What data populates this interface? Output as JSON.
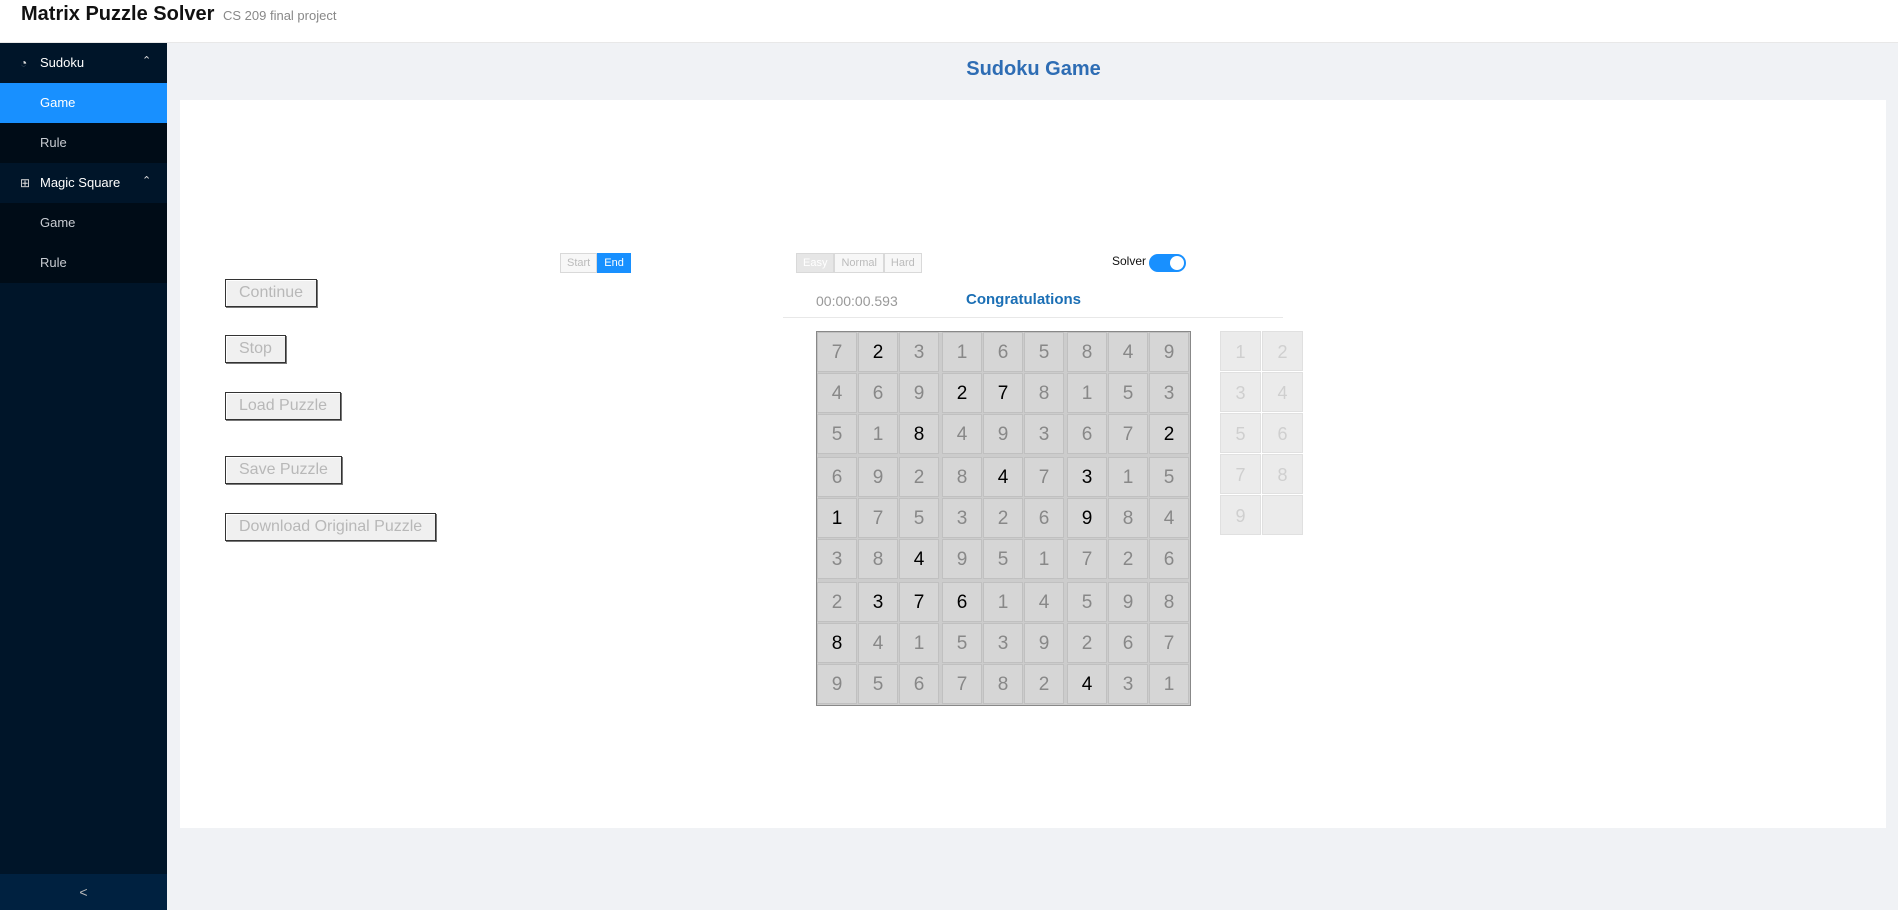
{
  "header": {
    "title": "Matrix Puzzle Solver",
    "subtitle": "CS 209 final project"
  },
  "sidebar": {
    "groups": [
      {
        "label": "Sudoku",
        "icon": "pie-chart-icon",
        "items": [
          {
            "label": "Game",
            "active": true
          },
          {
            "label": "Rule",
            "active": false
          }
        ]
      },
      {
        "label": "Magic Square",
        "icon": "grid-icon",
        "items": [
          {
            "label": "Game",
            "active": false
          },
          {
            "label": "Rule",
            "active": false
          }
        ]
      }
    ],
    "collapse_glyph": "<"
  },
  "page": {
    "title": "Sudoku Game"
  },
  "controls": {
    "buttons": {
      "continue": "Continue",
      "stop": "Stop",
      "load": "Load Puzzle",
      "save": "Save Puzzle",
      "download": "Download Original Puzzle"
    },
    "start_end": {
      "start": "Start",
      "end": "End",
      "selected": "End"
    },
    "difficulty": {
      "easy": "Easy",
      "normal": "Normal",
      "hard": "Hard",
      "selected": "Easy"
    },
    "solver": {
      "label": "Solver",
      "on": true
    }
  },
  "status": {
    "timer": "00:00:00.593",
    "message": "Congratulations"
  },
  "board": {
    "values": [
      [
        7,
        2,
        3,
        1,
        6,
        5,
        8,
        4,
        9
      ],
      [
        4,
        6,
        9,
        2,
        7,
        8,
        1,
        5,
        3
      ],
      [
        5,
        1,
        8,
        4,
        9,
        3,
        6,
        7,
        2
      ],
      [
        6,
        9,
        2,
        8,
        4,
        7,
        3,
        1,
        5
      ],
      [
        1,
        7,
        5,
        3,
        2,
        6,
        9,
        8,
        4
      ],
      [
        3,
        8,
        4,
        9,
        5,
        1,
        7,
        2,
        6
      ],
      [
        2,
        3,
        7,
        6,
        1,
        4,
        5,
        9,
        8
      ],
      [
        8,
        4,
        1,
        5,
        3,
        9,
        2,
        6,
        7
      ],
      [
        9,
        5,
        6,
        7,
        8,
        2,
        4,
        3,
        1
      ]
    ],
    "givens": [
      [
        0,
        1,
        0,
        0,
        0,
        0,
        0,
        0,
        0
      ],
      [
        0,
        0,
        0,
        1,
        1,
        0,
        0,
        0,
        0
      ],
      [
        0,
        0,
        1,
        0,
        0,
        0,
        0,
        0,
        1
      ],
      [
        0,
        0,
        0,
        0,
        1,
        0,
        1,
        0,
        0
      ],
      [
        1,
        0,
        0,
        0,
        0,
        0,
        1,
        0,
        0
      ],
      [
        0,
        0,
        1,
        0,
        0,
        0,
        0,
        0,
        0
      ],
      [
        0,
        1,
        1,
        1,
        0,
        0,
        0,
        0,
        0
      ],
      [
        1,
        0,
        0,
        0,
        0,
        0,
        0,
        0,
        0
      ],
      [
        0,
        0,
        0,
        0,
        0,
        0,
        1,
        0,
        0
      ]
    ]
  },
  "number_pad": [
    "1",
    "2",
    "3",
    "4",
    "5",
    "6",
    "7",
    "8",
    "9",
    ""
  ]
}
